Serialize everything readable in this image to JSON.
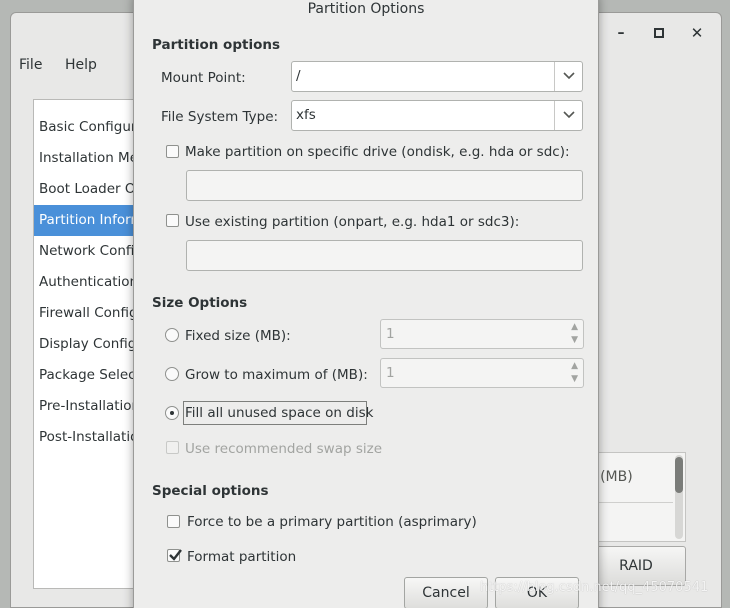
{
  "main_window": {
    "controls": {
      "minimize": "–",
      "maximize": "▫",
      "close": "✕"
    },
    "menu": [
      "File",
      "Help"
    ],
    "sidebar": [
      "Basic Configuration",
      "Installation Method",
      "Boot Loader Options",
      "Partition Information",
      "Network Configuration",
      "Authentication",
      "Firewall Configuration",
      "Display Configuration",
      "Package Selection",
      "Pre-Installation Script",
      "Post-Installation Script"
    ],
    "selected_sidebar_index": 3,
    "table_header_partial": "e (MB)",
    "raid_button": "RAID"
  },
  "dialog": {
    "title": "Partition Options",
    "partition_options": {
      "heading": "Partition options",
      "mount_point_label": "Mount Point:",
      "mount_point_value": "/",
      "fs_type_label": "File System Type:",
      "fs_type_value": "xfs",
      "ondisk_label": "Make partition on specific drive (ondisk, e.g. hda or sdc):",
      "ondisk_checked": false,
      "ondisk_value": "",
      "onpart_label": "Use existing partition (onpart, e.g. hda1 or sdc3):",
      "onpart_checked": false,
      "onpart_value": ""
    },
    "size_options": {
      "heading": "Size Options",
      "fixed_label": "Fixed size (MB):",
      "fixed_value": "1",
      "grow_label": "Grow to maximum of (MB):",
      "grow_value": "1",
      "fill_label": "Fill all unused space on disk",
      "selected": "fill",
      "swap_label": "Use recommended swap size",
      "swap_checked": false,
      "swap_enabled": false
    },
    "special_options": {
      "heading": "Special options",
      "primary_label": "Force to be a primary partition (asprimary)",
      "primary_checked": false,
      "format_label": "Format partition",
      "format_checked": true
    },
    "buttons": {
      "cancel": "Cancel",
      "ok": "OK"
    }
  },
  "watermark": "https://blog.csdn.net/qq_45070541",
  "colors": {
    "selection": "#4a90d9",
    "background": "#b5b8b5",
    "dialog": "#ededec"
  },
  "icons": [
    "minimize-icon",
    "maximize-icon",
    "close-icon",
    "chevron-down-icon",
    "checkmark-icon",
    "spin-up-icon",
    "spin-down-icon"
  ]
}
